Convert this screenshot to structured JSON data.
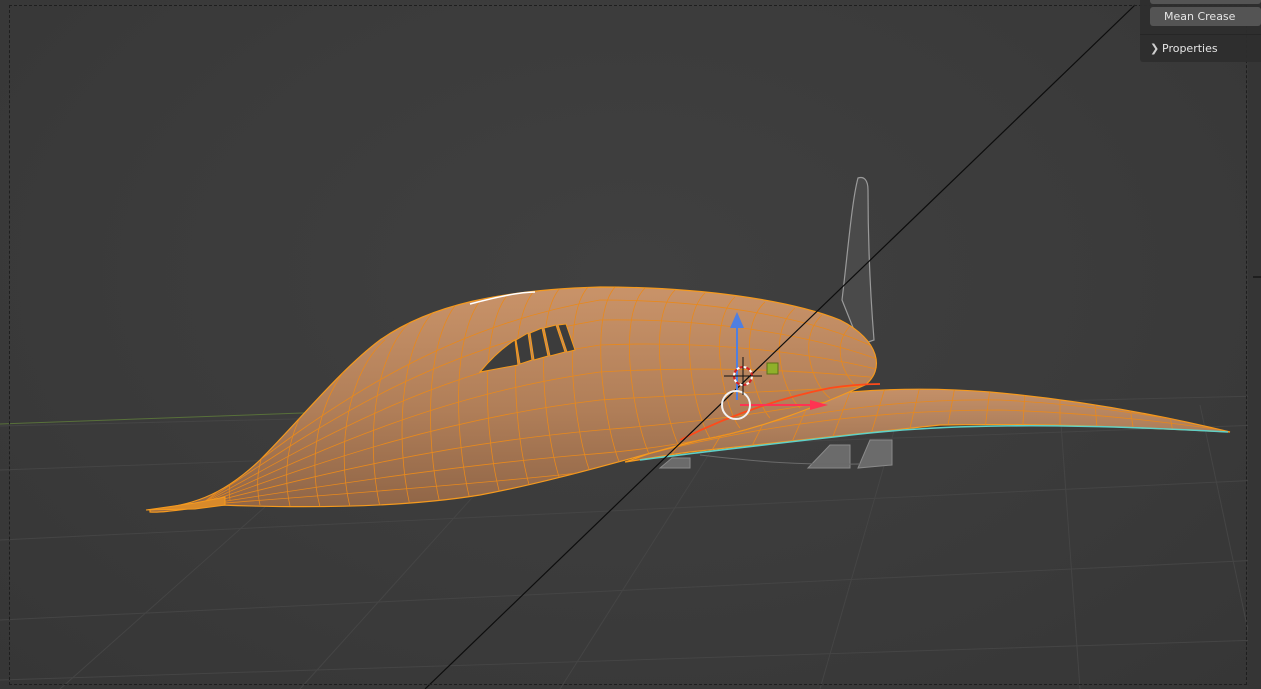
{
  "viewport": {
    "name": "3D Viewport",
    "mode": "Edit Mode"
  },
  "sidebar_panel": {
    "mean_crease_label": "Mean Crease",
    "properties_label": "Properties",
    "properties_expanded": false
  },
  "colors": {
    "background": "#3a3a3a",
    "grid_line": "#444444",
    "mesh_selected_face": "#b8855a",
    "mesh_wire": "#f59a1e",
    "axis_x": "#ff3352",
    "axis_z": "#4f7fe0",
    "seam_edge": "#5fd0c8",
    "unselected_mesh": "#9a9a9a"
  },
  "icons": {
    "properties_chevron": "chevron-right-icon",
    "object_origin": "object-origin-icon",
    "3d_cursor": "3d-cursor-icon"
  }
}
